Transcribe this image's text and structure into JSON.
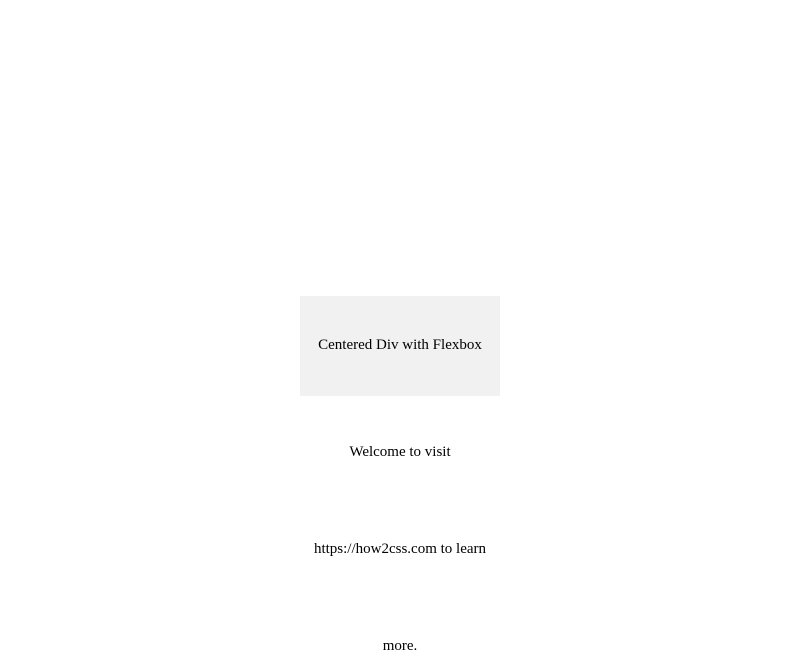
{
  "box": {
    "text": "Centered Div with Flexbox"
  },
  "lines": {
    "line1": "Welcome to visit",
    "line2": "https://how2css.com to learn",
    "line3": "more."
  }
}
